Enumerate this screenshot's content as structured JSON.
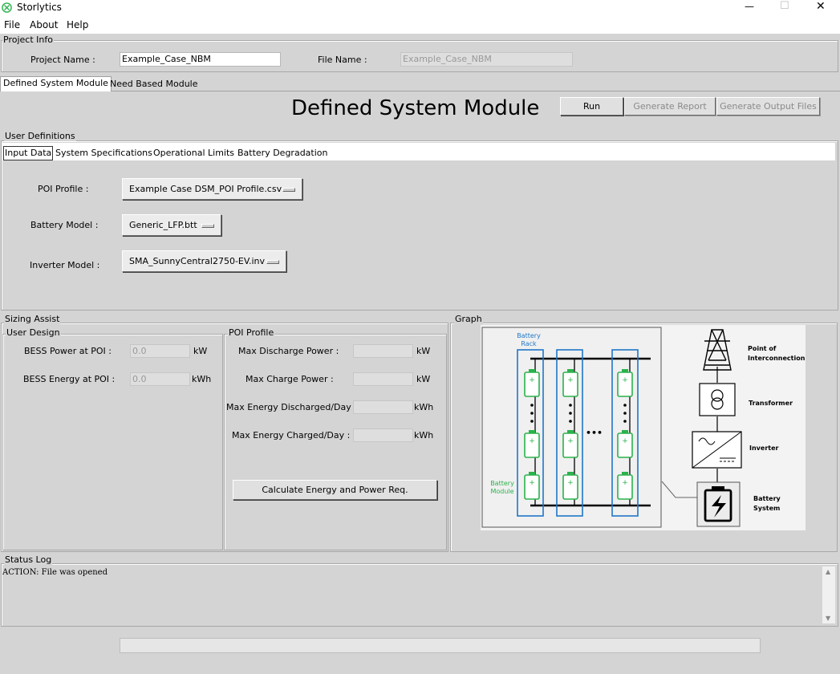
{
  "app": {
    "title": "Storlytics",
    "controls": {
      "minimize": "—",
      "maximize": "☐",
      "close": "✕"
    }
  },
  "menu": [
    "File",
    "About",
    "Help"
  ],
  "project_info": {
    "legend": "Project Info",
    "project_name_label": "Project Name :",
    "project_name_value": "Example_Case_NBM",
    "file_name_label": "File Name :",
    "file_name_value": "Example_Case_NBM"
  },
  "module_tabs": [
    "Defined System Module",
    "Need Based Module"
  ],
  "header": {
    "title": "Defined System Module",
    "run": "Run",
    "generate_report": "Generate Report",
    "generate_output": "Generate Output Files"
  },
  "user_definitions": {
    "legend": "User Definitions",
    "tabs": [
      "Input Data",
      "System Specifications",
      "Operational Limits",
      "Battery Degradation"
    ],
    "poi_label": "POI Profile :",
    "poi_value": "Example Case DSM_POI Profile.csv",
    "battery_label": "Battery Model :",
    "battery_value": "Generic_LFP.btt",
    "inverter_label": "Inverter Model :",
    "inverter_value": "SMA_SunnyCentral2750-EV.inv"
  },
  "sizing": {
    "legend": "Sizing Assist",
    "user_design": {
      "legend": "User Design",
      "rows": [
        {
          "label": "BESS Power at POI :",
          "value": "0.0",
          "unit": "kW"
        },
        {
          "label": "BESS Energy at POI :",
          "value": "0.0",
          "unit": "kWh"
        }
      ]
    },
    "poi_profile": {
      "legend": "POI Profile",
      "rows": [
        {
          "label": "Max Discharge Power :",
          "value": "",
          "unit": "kW"
        },
        {
          "label": "Max Charge Power :",
          "value": "",
          "unit": "kW"
        },
        {
          "label": "Max Energy Discharged/Day :",
          "value": "",
          "unit": "kWh"
        },
        {
          "label": "Max Energy Charged/Day :",
          "value": "",
          "unit": "kWh"
        }
      ],
      "calc_button": "Calculate Energy and Power Req."
    }
  },
  "graph": {
    "legend": "Graph",
    "labels": {
      "battery_rack": [
        "Battery",
        "Rack"
      ],
      "battery_module": [
        "Battery",
        "Module"
      ],
      "poi": [
        "Point of",
        "Interconnection"
      ],
      "transformer": "Transformer",
      "inverter": "Inverter",
      "battery_system": [
        "Battery",
        "System"
      ],
      "ellipsis": "•••"
    },
    "colors": {
      "rack": "#1f77c9",
      "cell": "#2bb24c"
    }
  },
  "status_log": {
    "legend": "Status Log",
    "entries": [
      "ACTION: File was opened"
    ]
  },
  "progress": 0
}
